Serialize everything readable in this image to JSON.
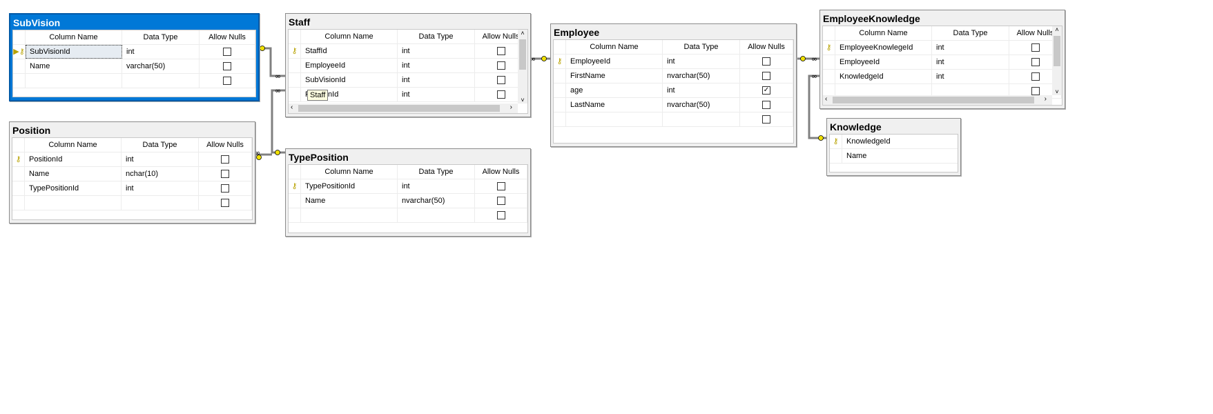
{
  "tables": [
    {
      "name": "SubVision",
      "selected": true,
      "scroll": false,
      "headers": [
        "Column Name",
        "Data Type",
        "Allow Nulls"
      ],
      "columns": [
        {
          "name": "SubVisionId",
          "type": "int",
          "nulls": false,
          "pk": true,
          "current": true
        },
        {
          "name": "Name",
          "type": "varchar(50)",
          "nulls": false
        },
        {
          "name": "",
          "type": "",
          "nulls": false
        }
      ]
    },
    {
      "name": "Staff",
      "selected": false,
      "scroll": true,
      "headers": [
        "Column Name",
        "Data Type",
        "Allow Nulls"
      ],
      "columns": [
        {
          "name": "StaffId",
          "type": "int",
          "nulls": false,
          "pk": true
        },
        {
          "name": "EmployeeId",
          "type": "int",
          "nulls": false
        },
        {
          "name": "SubVisionId",
          "type": "int",
          "nulls": false
        },
        {
          "name": "PositionId",
          "type": "int",
          "nulls": false
        }
      ]
    },
    {
      "name": "Position",
      "selected": false,
      "scroll": false,
      "headers": [
        "Column Name",
        "Data Type",
        "Allow Nulls"
      ],
      "columns": [
        {
          "name": "PositionId",
          "type": "int",
          "nulls": false,
          "pk": true
        },
        {
          "name": "Name",
          "type": "nchar(10)",
          "nulls": false
        },
        {
          "name": "TypePositionId",
          "type": "int",
          "nulls": false
        },
        {
          "name": "",
          "type": "",
          "nulls": false
        }
      ]
    },
    {
      "name": "TypePosition",
      "selected": false,
      "scroll": false,
      "headers": [
        "Column Name",
        "Data Type",
        "Allow Nulls"
      ],
      "columns": [
        {
          "name": "TypePositionId",
          "type": "int",
          "nulls": false,
          "pk": true
        },
        {
          "name": "Name",
          "type": "nvarchar(50)",
          "nulls": false
        },
        {
          "name": "",
          "type": "",
          "nulls": false
        }
      ]
    },
    {
      "name": "Employee",
      "selected": false,
      "scroll": false,
      "headers": [
        "Column Name",
        "Data Type",
        "Allow Nulls"
      ],
      "columns": [
        {
          "name": "EmployeeId",
          "type": "int",
          "nulls": false,
          "pk": true
        },
        {
          "name": "FirstName",
          "type": "nvarchar(50)",
          "nulls": false
        },
        {
          "name": "age",
          "type": "int",
          "nulls": true
        },
        {
          "name": "LastName",
          "type": "nvarchar(50)",
          "nulls": false
        },
        {
          "name": "",
          "type": "",
          "nulls": false
        }
      ]
    },
    {
      "name": "EmployeeKnowledge",
      "selected": false,
      "scroll": true,
      "headers": [
        "Column Name",
        "Data Type",
        "Allow Nulls"
      ],
      "columns": [
        {
          "name": "EmployeeKnowlegeId",
          "type": "int",
          "nulls": false,
          "pk": true
        },
        {
          "name": "EmployeeId",
          "type": "int",
          "nulls": false
        },
        {
          "name": "KnowledgeId",
          "type": "int",
          "nulls": false
        },
        {
          "name": "",
          "type": "",
          "nulls": false
        }
      ]
    },
    {
      "name": "Knowledge",
      "selected": false,
      "scroll": false,
      "nameOnly": true,
      "columns": [
        {
          "name": "KnowledgeId",
          "pk": true
        },
        {
          "name": "Name"
        }
      ]
    }
  ],
  "tooltip": "Staff",
  "icons": {
    "primary_key": "key-icon",
    "current_row": "row-pointer-icon",
    "fk_many": "infinity-icon",
    "fk_one": "key-icon"
  },
  "colors": {
    "selected_title": "#0078d7",
    "key": "#f0e000"
  }
}
